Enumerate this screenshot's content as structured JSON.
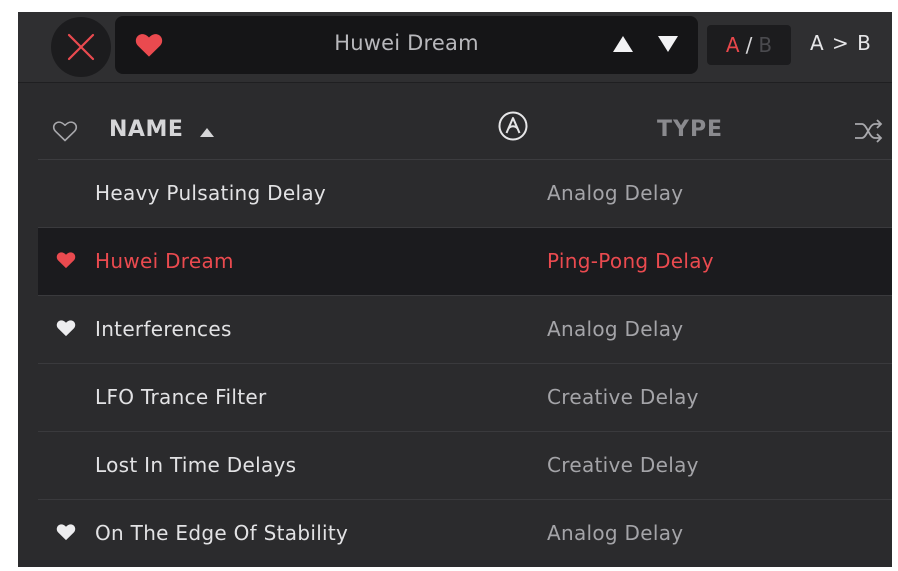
{
  "header": {
    "preset_name": "Huwei Dream",
    "preset_favorite": true,
    "ab": {
      "a": "A",
      "slash": "/",
      "b": "B"
    },
    "copy_label": "A > B"
  },
  "columns": {
    "name": "NAME",
    "type": "TYPE"
  },
  "colors": {
    "accent": "#e8474b",
    "background": "#2b2b2d",
    "selected_row": "#1b1b1e"
  },
  "presets": [
    {
      "name": "Heavy Pulsating Delay",
      "type": "Analog Delay",
      "favorite": false,
      "selected": false
    },
    {
      "name": "Huwei Dream",
      "type": "Ping-Pong Delay",
      "favorite": true,
      "selected": true
    },
    {
      "name": "Interferences",
      "type": "Analog Delay",
      "favorite": true,
      "selected": false
    },
    {
      "name": "LFO Trance Filter",
      "type": "Creative Delay",
      "favorite": false,
      "selected": false
    },
    {
      "name": "Lost In Time Delays",
      "type": "Creative Delay",
      "favorite": false,
      "selected": false
    },
    {
      "name": "On The Edge Of Stability",
      "type": "Analog Delay",
      "favorite": true,
      "selected": false
    }
  ]
}
